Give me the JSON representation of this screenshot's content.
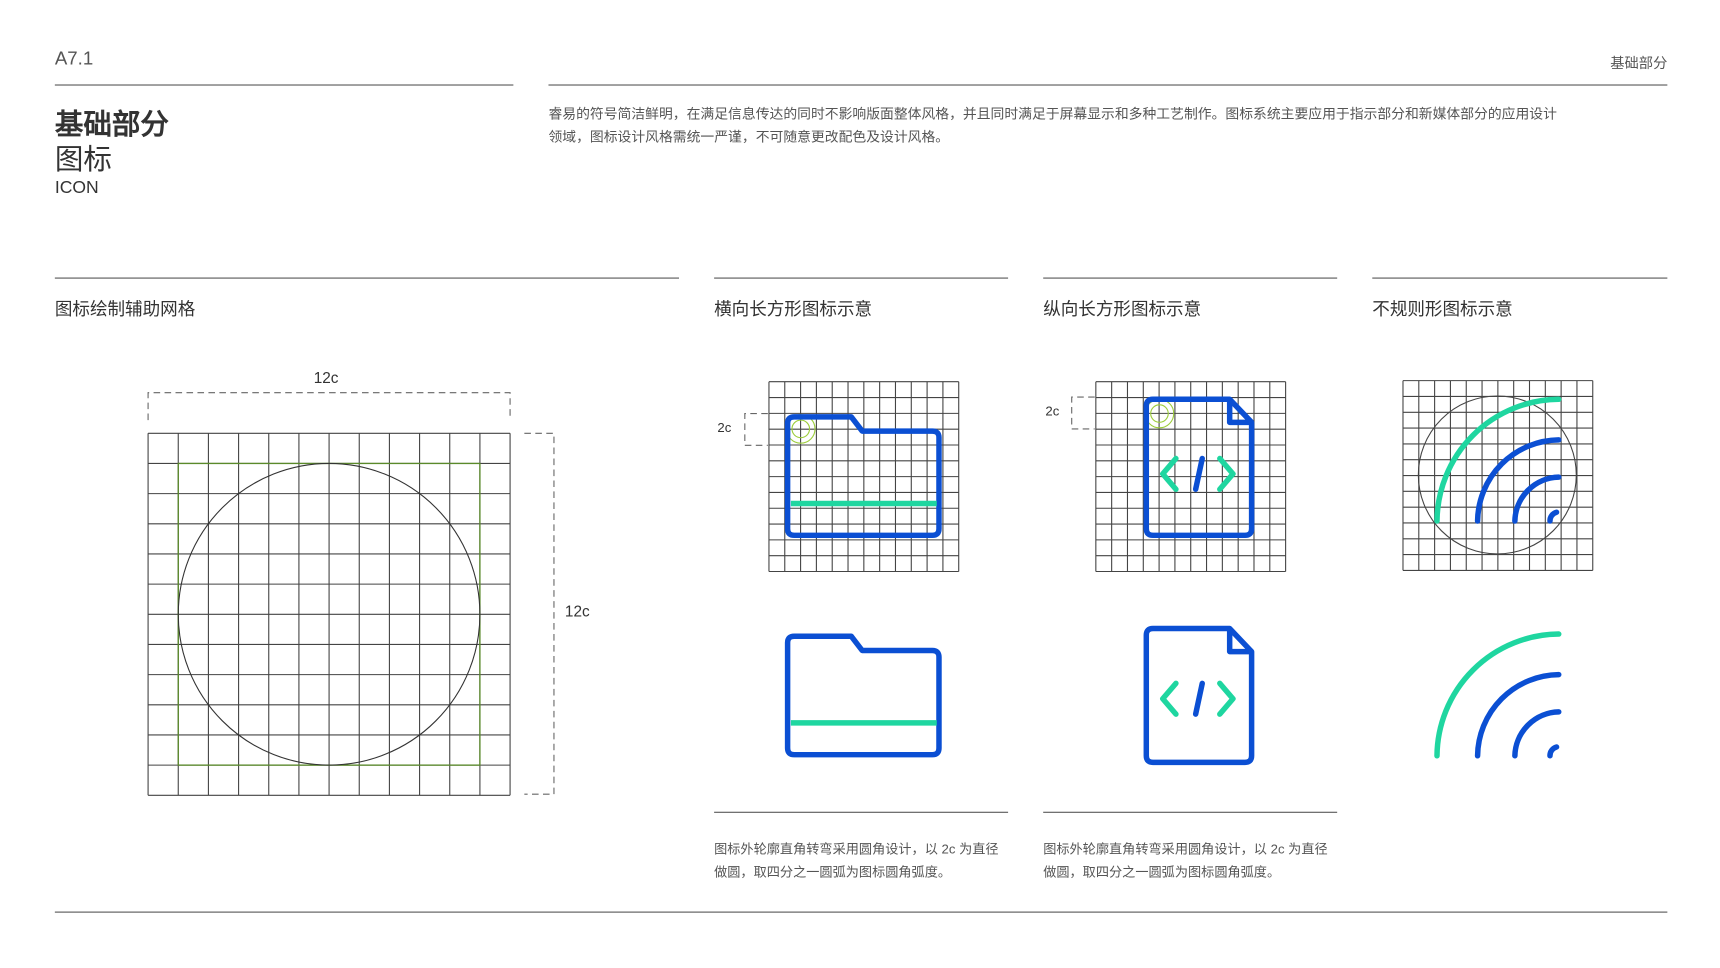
{
  "header": {
    "section_code": "A7.1",
    "section_name": "基础部分"
  },
  "title": {
    "main": "基础部分",
    "sub": "图标",
    "en": "ICON"
  },
  "description": [
    "睿易的符号简洁鲜明，在满足信息传达的同时不影响版面整体风格，并且同时满足于屏幕显示和多种工艺制作。图标系统主要应用于指示部分和新媒体部分的应用设计",
    "领域，图标设计风格需统一严谨，不可随意更改配色及设计风格。"
  ],
  "sections": [
    {
      "heading": "图标绘制辅助网格",
      "width_label": "12c",
      "height_label": "12c"
    },
    {
      "heading": "横向长方形图标示意",
      "corner_label": "2c",
      "caption": [
        "图标外轮廓直角转弯采用圆角设计，以 2c 为直径",
        "做圆，取四分之一圆弧为图标圆角弧度。"
      ]
    },
    {
      "heading": "纵向长方形图标示意",
      "corner_label": "2c",
      "caption": [
        "图标外轮廓直角转弯采用圆角设计，以 2c 为直径",
        "做圆，取四分之一圆弧为图标圆角弧度。"
      ]
    },
    {
      "heading": "不规则形图标示意"
    }
  ],
  "icons": [
    "folder-icon",
    "code-file-icon",
    "wifi-icon"
  ],
  "colors": {
    "blue": "#0b4fd3",
    "green": "#1fd6a0",
    "guide_green": "#5a8a2a"
  }
}
